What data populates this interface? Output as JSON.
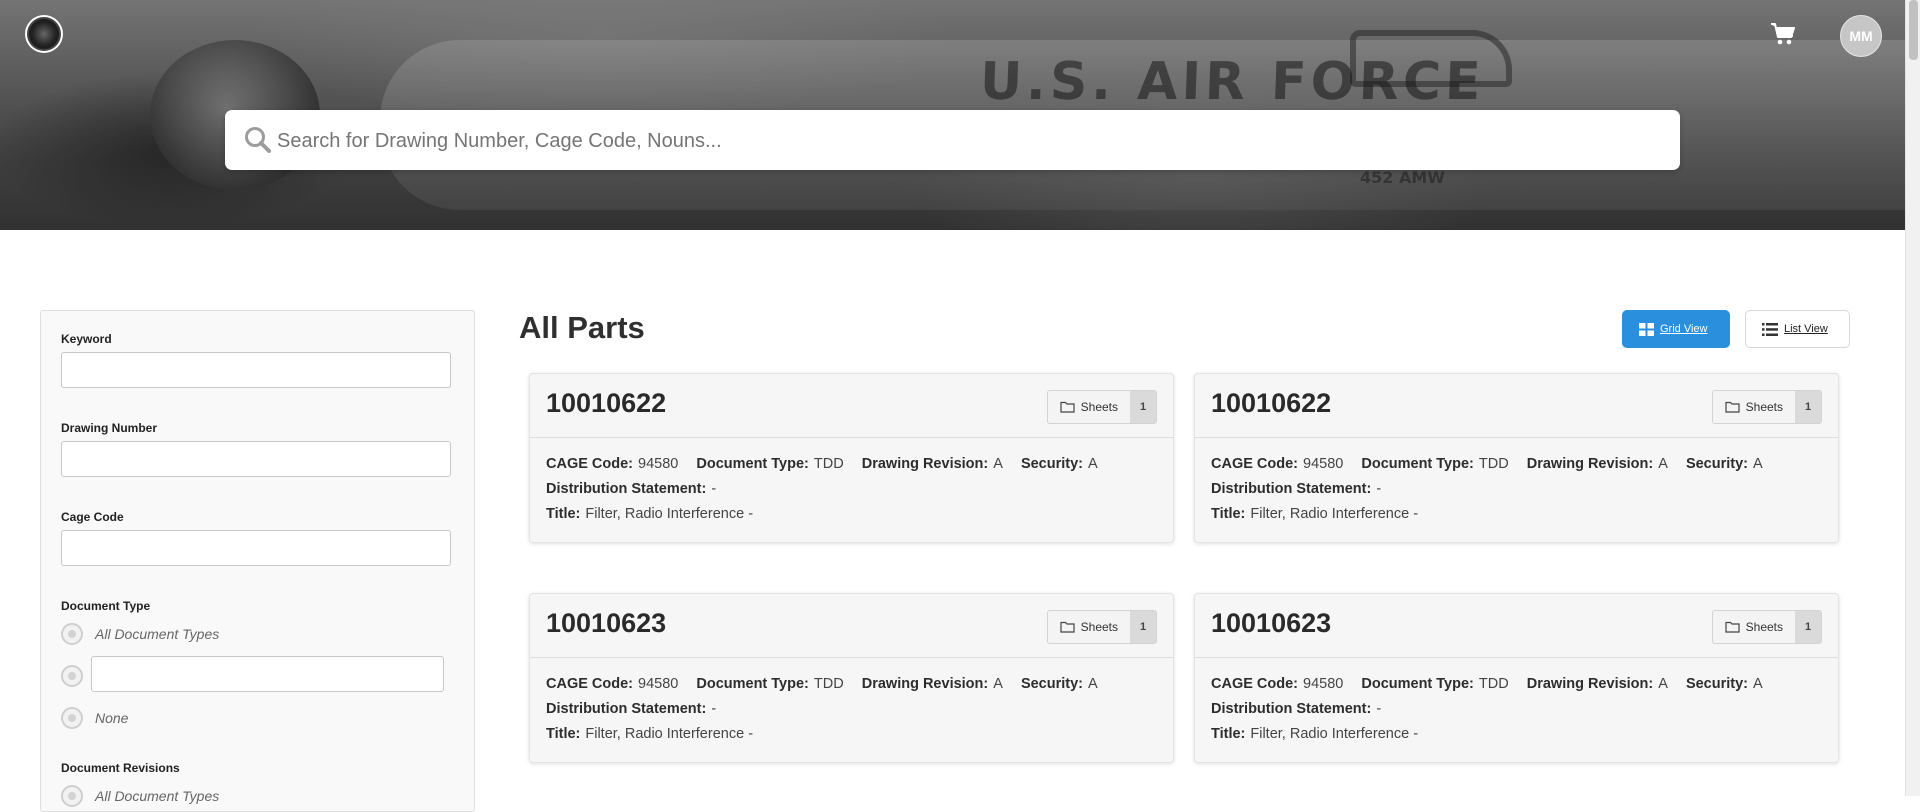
{
  "header": {
    "logo_icon": "seal-logo-icon",
    "cart_icon": "cart-icon",
    "avatar_initials": "MM",
    "hero_text": "U.S. AIR FORCE",
    "hero_unit": "452 AMW",
    "search_placeholder": "Search for Drawing Number, Cage Code, Nouns..."
  },
  "sidebar": {
    "keyword_label": "Keyword",
    "drawing_number_label": "Drawing Number",
    "cage_code_label": "Cage Code",
    "document_type_label": "Document Type",
    "document_type_options": [
      "All Document Types",
      "",
      "None"
    ],
    "document_revisions_label": "Document Revisions",
    "document_revisions_options": [
      "All Document Types"
    ]
  },
  "main": {
    "title": "All Parts",
    "grid_view_label": "Grid View",
    "list_view_label": "List View",
    "labels": {
      "cage": "CAGE Code:",
      "doctype": "Document Type:",
      "revision": "Drawing Revision:",
      "security": "Security:",
      "distribution": "Distribution Statement:",
      "title": "Title:",
      "sheets": "Sheets"
    },
    "cards": [
      {
        "number": "10010622",
        "sheets": "1",
        "cage": "94580",
        "doctype": "TDD",
        "revision": "A",
        "security": "A",
        "distribution": "-",
        "title": "Filter, Radio Interference",
        "title_suffix": "-"
      },
      {
        "number": "10010622",
        "sheets": "1",
        "cage": "94580",
        "doctype": "TDD",
        "revision": "A",
        "security": "A",
        "distribution": "-",
        "title": "Filter, Radio Interference",
        "title_suffix": "-"
      },
      {
        "number": "10010623",
        "sheets": "1",
        "cage": "94580",
        "doctype": "TDD",
        "revision": "A",
        "security": "A",
        "distribution": "-",
        "title": "Filter, Radio Interference",
        "title_suffix": "-"
      },
      {
        "number": "10010623",
        "sheets": "1",
        "cage": "94580",
        "doctype": "TDD",
        "revision": "A",
        "security": "A",
        "distribution": "-",
        "title": "Filter, Radio Interference",
        "title_suffix": "-"
      }
    ]
  },
  "colors": {
    "primary": "#2a8fdc",
    "card_bg": "#f6f6f6"
  }
}
